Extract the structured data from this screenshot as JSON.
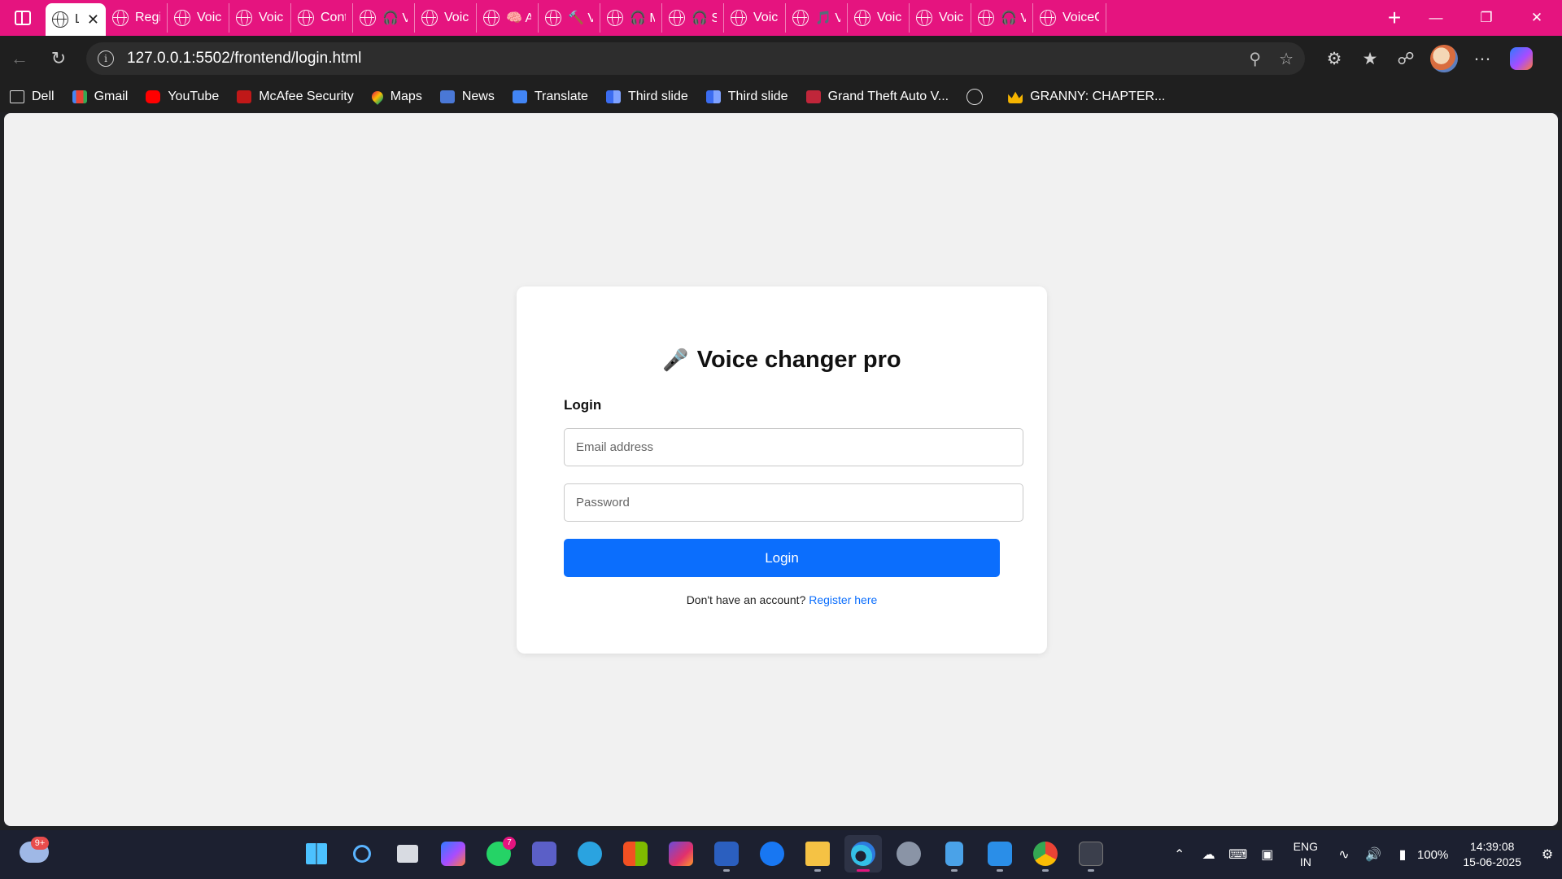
{
  "browser": {
    "tabs": [
      {
        "label": "Lo",
        "active": true
      },
      {
        "label": "Regist"
      },
      {
        "label": "VoiceC"
      },
      {
        "label": "VoiceC"
      },
      {
        "label": "Conta"
      },
      {
        "label": "🎧 Vo"
      },
      {
        "label": "VoiceT"
      },
      {
        "label": "🧠 AI"
      },
      {
        "label": "🔨 Vo"
      },
      {
        "label": "🎧 Mi"
      },
      {
        "label": "🎧 Stu"
      },
      {
        "label": "VoiceC"
      },
      {
        "label": "🎵 Vo"
      },
      {
        "label": "Voice"
      },
      {
        "label": "VoiceC"
      },
      {
        "label": "🎧 Vo"
      },
      {
        "label": "VoiceC"
      }
    ],
    "url": "127.0.0.1:5502/frontend/login.html",
    "bookmarks": [
      {
        "label": "Dell",
        "icon": "folder-icon"
      },
      {
        "label": "Gmail",
        "icon": "gmail-icon"
      },
      {
        "label": "YouTube",
        "icon": "youtube-icon"
      },
      {
        "label": "McAfee Security",
        "icon": "mcafee-icon"
      },
      {
        "label": "Maps",
        "icon": "maps-icon"
      },
      {
        "label": "News",
        "icon": "news-icon"
      },
      {
        "label": "Translate",
        "icon": "translate-icon"
      },
      {
        "label": "Third slide",
        "icon": "slide-icon"
      },
      {
        "label": "Third slide",
        "icon": "slide-icon"
      },
      {
        "label": "Grand Theft Auto V...",
        "icon": "gta-icon"
      },
      {
        "label": "",
        "icon": "globe-icon"
      },
      {
        "label": "GRANNY: CHAPTER...",
        "icon": "crown-icon"
      }
    ]
  },
  "page": {
    "title": "Voice changer pro",
    "title_icon": "🎤",
    "section_label": "Login",
    "email_placeholder": "Email address",
    "password_placeholder": "Password",
    "login_button": "Login",
    "register_prompt": "Don't have an account?",
    "register_link": "Register here"
  },
  "taskbar": {
    "weather_badge": "9+",
    "whatsapp_badge": "7",
    "language_line1": "ENG",
    "language_line2": "IN",
    "battery": "100%",
    "time": "14:39:08",
    "date": "15-06-2025"
  },
  "colors": {
    "tab_strip": "#e5147f",
    "primary_button": "#0b6efd",
    "page_background": "#f1f1f1"
  }
}
